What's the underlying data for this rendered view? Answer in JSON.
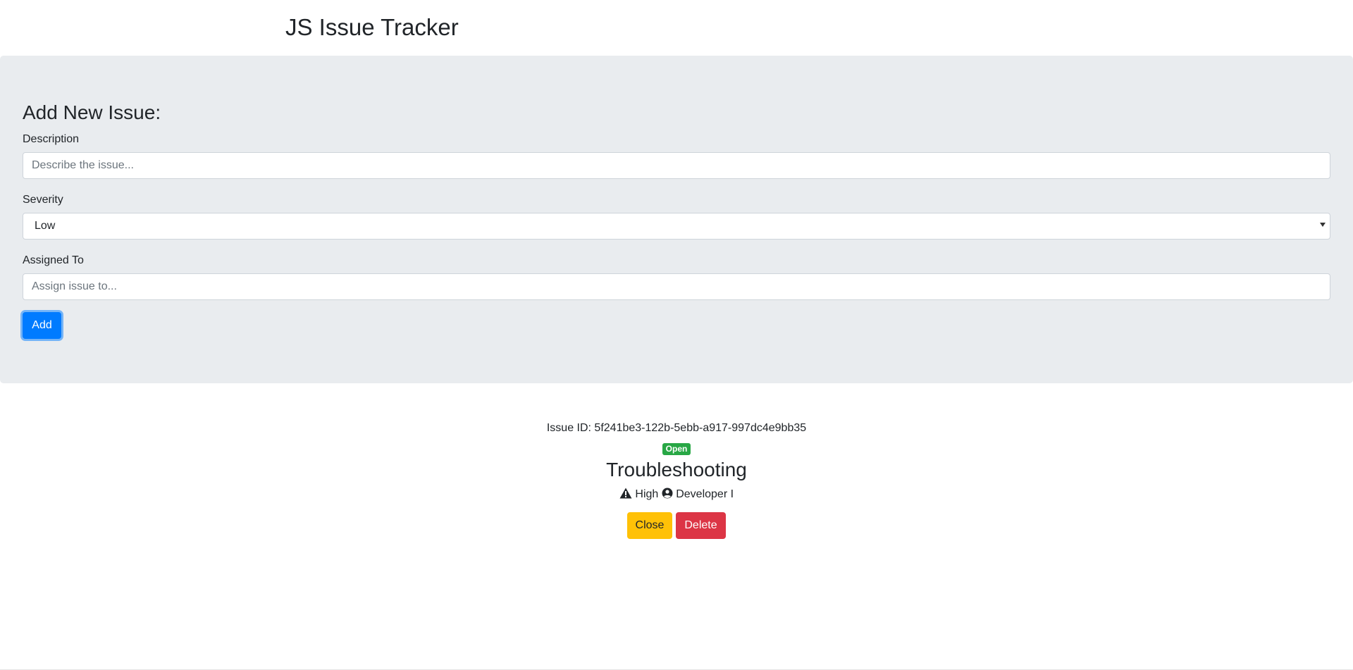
{
  "header": {
    "title": "JS Issue Tracker"
  },
  "form": {
    "heading": "Add New Issue:",
    "description": {
      "label": "Description",
      "placeholder": "Describe the issue...",
      "value": ""
    },
    "severity": {
      "label": "Severity",
      "selected": "Low"
    },
    "assigned_to": {
      "label": "Assigned To",
      "placeholder": "Assign issue to...",
      "value": ""
    },
    "add_label": "Add"
  },
  "issue": {
    "id_label": "Issue ID: 5f241be3-122b-5ebb-a917-997dc4e9bb35",
    "status": "Open",
    "title": "Troubleshooting",
    "severity": "High",
    "assignee": "Developer I",
    "close_label": "Close",
    "delete_label": "Delete",
    "severity_icon": "warning-icon",
    "assignee_icon": "user-circle-icon"
  },
  "colors": {
    "primary": "#007bff",
    "warning": "#ffc107",
    "danger": "#dc3545",
    "success": "#28a745",
    "jumbotron": "#e9ecef"
  }
}
